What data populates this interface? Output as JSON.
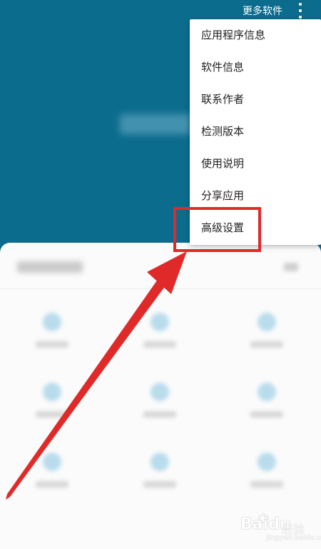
{
  "toolbar": {
    "more_software": "更多软件",
    "overflow_icon": "more-vert"
  },
  "menu": {
    "items": [
      {
        "label": "应用程序信息"
      },
      {
        "label": "软件信息"
      },
      {
        "label": "联系作者"
      },
      {
        "label": "检测版本"
      },
      {
        "label": "使用说明"
      },
      {
        "label": "分享应用"
      },
      {
        "label": "高级设置"
      }
    ],
    "highlighted_item": "高级设置"
  },
  "annotation": {
    "box_color": "#e02a2a",
    "arrow_color": "#e02a2a"
  },
  "colors": {
    "header_bg": "#0c6c8e",
    "menu_bg": "#ffffff",
    "sheet_bg": "#fbfbfb"
  },
  "watermark": {
    "logo": "Baidu",
    "sub": "经验",
    "url": "jingyan.baidu.com"
  }
}
